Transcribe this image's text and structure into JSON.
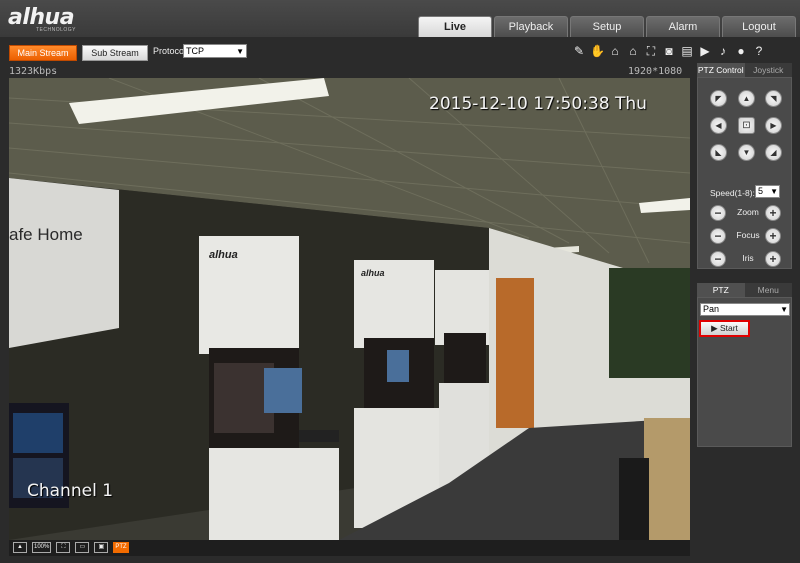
{
  "header": {
    "logo": "alhua",
    "logo_sub": "TECHNOLOGY",
    "tabs": [
      {
        "label": "Live",
        "active": true
      },
      {
        "label": "Playback"
      },
      {
        "label": "Setup"
      },
      {
        "label": "Alarm"
      },
      {
        "label": "Logout"
      }
    ]
  },
  "toolbar": {
    "main_stream": "Main Stream",
    "sub_stream": "Sub Stream",
    "protocol_label": "Protocol",
    "protocol_value": "TCP"
  },
  "stats": {
    "bitrate": "1323Kbps",
    "resolution": "1920*1080"
  },
  "video": {
    "timestamp": "2015-12-10 17:50:38 Thu",
    "channel": "Channel 1",
    "scene_texts": [
      "afe Home",
      "alhua",
      "alhua"
    ]
  },
  "bottombar": {
    "zoom": "100%",
    "ptz": "PTZ"
  },
  "ptz_panel": {
    "tabs": [
      "PTZ Control",
      "Joystick"
    ],
    "speed_label": "Speed(1-8):",
    "speed_value": "5",
    "zoom_label": "Zoom",
    "focus_label": "Focus",
    "iris_label": "Iris"
  },
  "settings_panel": {
    "tabs": [
      "PTZ Settings",
      "Menu"
    ],
    "mode_value": "Pan",
    "start_label": "Start"
  },
  "colors": {
    "accent": "#f26b00",
    "highlight": "#e00000"
  }
}
